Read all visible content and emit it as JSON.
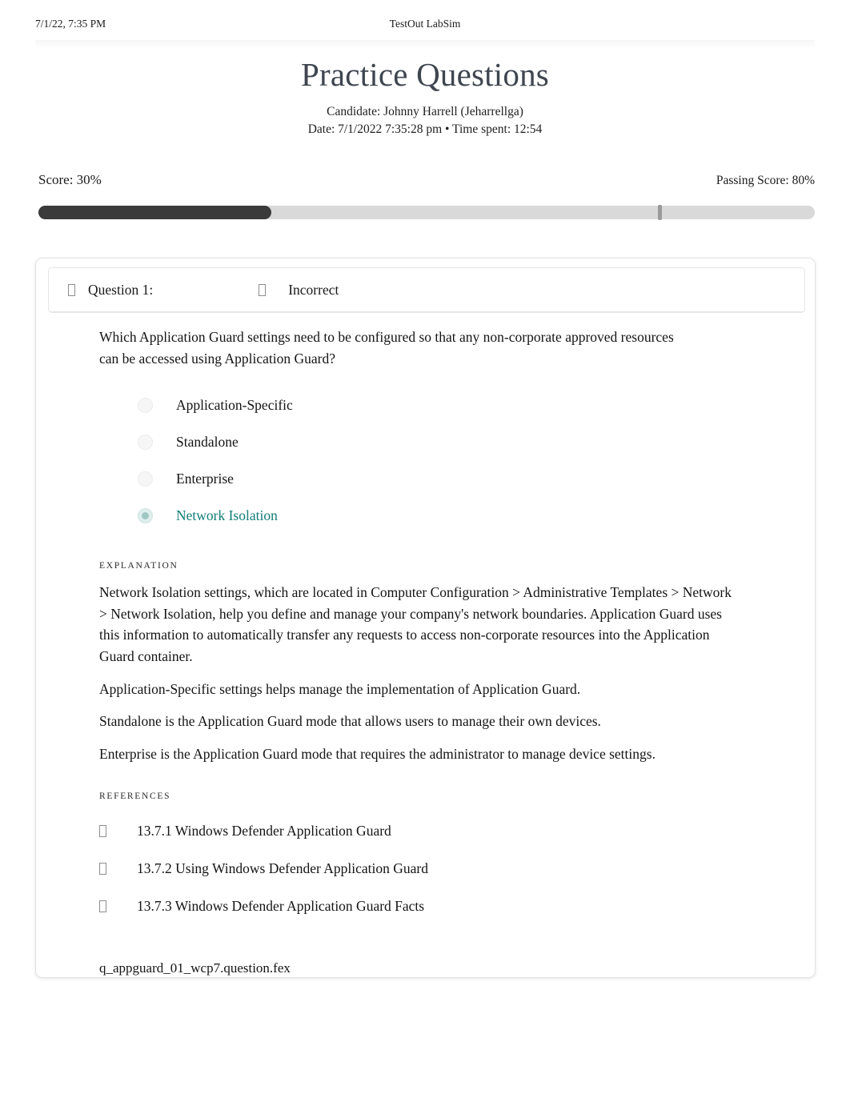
{
  "print_header": {
    "timestamp": "7/1/22, 7:35 PM",
    "app_name": "TestOut LabSim"
  },
  "title_block": {
    "title": "Practice Questions",
    "candidate": "Candidate: Johnny Harrell (Jeharrellga)",
    "date_line": "Date: 7/1/2022 7:35:28 pm • Time spent: 12:54"
  },
  "score": {
    "score_label": "Score: 30%",
    "passing_label": "Passing Score: 80%",
    "score_percent": 30,
    "passing_percent": 80,
    "fill_color": "#3a3a3a",
    "track_color": "#d9d9d9",
    "marker_color": "#9a9a9a"
  },
  "question": {
    "icon": "missing-glyph-box-icon",
    "number_label": "Question 1:",
    "status_icon": "missing-glyph-box-icon",
    "status_label": "Incorrect",
    "prompt": "Which Application Guard settings need to be configured so that any non-corporate approved resources can be accessed using Application Guard?",
    "options": [
      {
        "label": "Application-Specific",
        "selected": false,
        "correct": false
      },
      {
        "label": "Standalone",
        "selected": false,
        "correct": false
      },
      {
        "label": "Enterprise",
        "selected": false,
        "correct": false
      },
      {
        "label": "Network Isolation",
        "selected": true,
        "correct": true
      }
    ],
    "correct_color": "#127d78"
  },
  "explanation": {
    "heading": "EXPLANATION",
    "paragraphs": [
      "Network Isolation settings, which are located in Computer Configuration > Administrative Templates > Network > Network Isolation, help you define and manage your company's network boundaries. Application Guard uses this information to automatically transfer any requests to access non-corporate resources into the Application Guard container.",
      "Application-Specific settings helps manage the implementation of Application Guard.",
      "Standalone is the Application Guard mode that allows users to manage their own devices.",
      "Enterprise is the Application Guard mode that requires the administrator to manage device settings."
    ]
  },
  "references": {
    "heading": "REFERENCES",
    "items": [
      {
        "icon": "missing-glyph-box-icon",
        "label": "13.7.1 Windows Defender Application Guard"
      },
      {
        "icon": "missing-glyph-box-icon",
        "label": "13.7.2 Using Windows Defender Application Guard"
      },
      {
        "icon": "missing-glyph-box-icon",
        "label": "13.7.3 Windows Defender Application Guard Facts"
      }
    ]
  },
  "footer": {
    "file_id": "q_appguard_01_wcp7.question.fex"
  }
}
